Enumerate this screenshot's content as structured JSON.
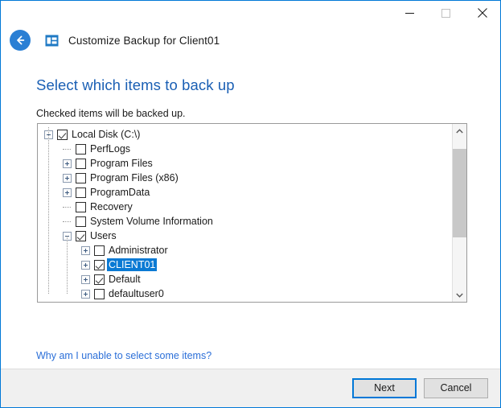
{
  "window": {
    "title": "Customize Backup for Client01",
    "icon": "window-panel-icon",
    "accent_color": "#0078D7",
    "back_button_label": "Back",
    "caption": {
      "minimize_label": "Minimize",
      "maximize_label": "Maximize",
      "close_label": "Close"
    }
  },
  "page": {
    "heading": "Select which items to back up",
    "heading_color": "#1A5FB4",
    "instruction": "Checked items will be backed up."
  },
  "tree": {
    "selection_color": "#0B7AD4",
    "items": [
      {
        "label": "Local Disk (C:\\)",
        "depth": 0,
        "checked": true,
        "expander": "minus"
      },
      {
        "label": "PerfLogs",
        "depth": 1,
        "checked": false,
        "expander": "none"
      },
      {
        "label": "Program Files",
        "depth": 1,
        "checked": false,
        "expander": "plus"
      },
      {
        "label": "Program Files (x86)",
        "depth": 1,
        "checked": false,
        "expander": "plus"
      },
      {
        "label": "ProgramData",
        "depth": 1,
        "checked": false,
        "expander": "plus"
      },
      {
        "label": "Recovery",
        "depth": 1,
        "checked": false,
        "expander": "none"
      },
      {
        "label": "System Volume Information",
        "depth": 1,
        "checked": false,
        "expander": "none"
      },
      {
        "label": "Users",
        "depth": 1,
        "checked": true,
        "expander": "minus"
      },
      {
        "label": "Administrator",
        "depth": 2,
        "checked": false,
        "expander": "plus"
      },
      {
        "label": "CLIENT01",
        "depth": 2,
        "checked": true,
        "expander": "plus",
        "selected": true
      },
      {
        "label": "Default",
        "depth": 2,
        "checked": true,
        "expander": "plus"
      },
      {
        "label": "defaultuser0",
        "depth": 2,
        "checked": false,
        "expander": "plus"
      }
    ],
    "scrollbar": {
      "up_label": "Scroll up",
      "down_label": "Scroll down"
    }
  },
  "help": {
    "link_text": "Why am I unable to select some items?",
    "link_color": "#2B6FD8"
  },
  "footer": {
    "next_label": "Next",
    "cancel_label": "Cancel"
  }
}
